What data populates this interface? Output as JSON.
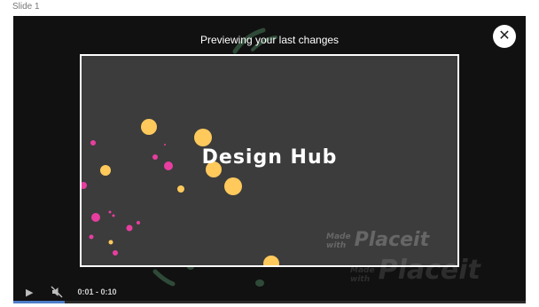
{
  "slide": {
    "label": "Slide 1"
  },
  "modal": {
    "title": "Previewing your last changes",
    "close_icon": "close-icon",
    "close_glyph": "✕"
  },
  "preview": {
    "design_title": "Design Hub",
    "watermark_made": "Made",
    "watermark_with": "with",
    "watermark_brand": "Placeit",
    "dot_colors": {
      "yellow": "#ffc95c",
      "pink": "#e83ea0"
    }
  },
  "player": {
    "play_icon": "play-icon",
    "play_glyph": "▶",
    "mute_icon": "muted-speaker-icon",
    "time": "0:01 - 0:10",
    "progress_fraction": 0.1,
    "accent": "#4d7dc9"
  }
}
